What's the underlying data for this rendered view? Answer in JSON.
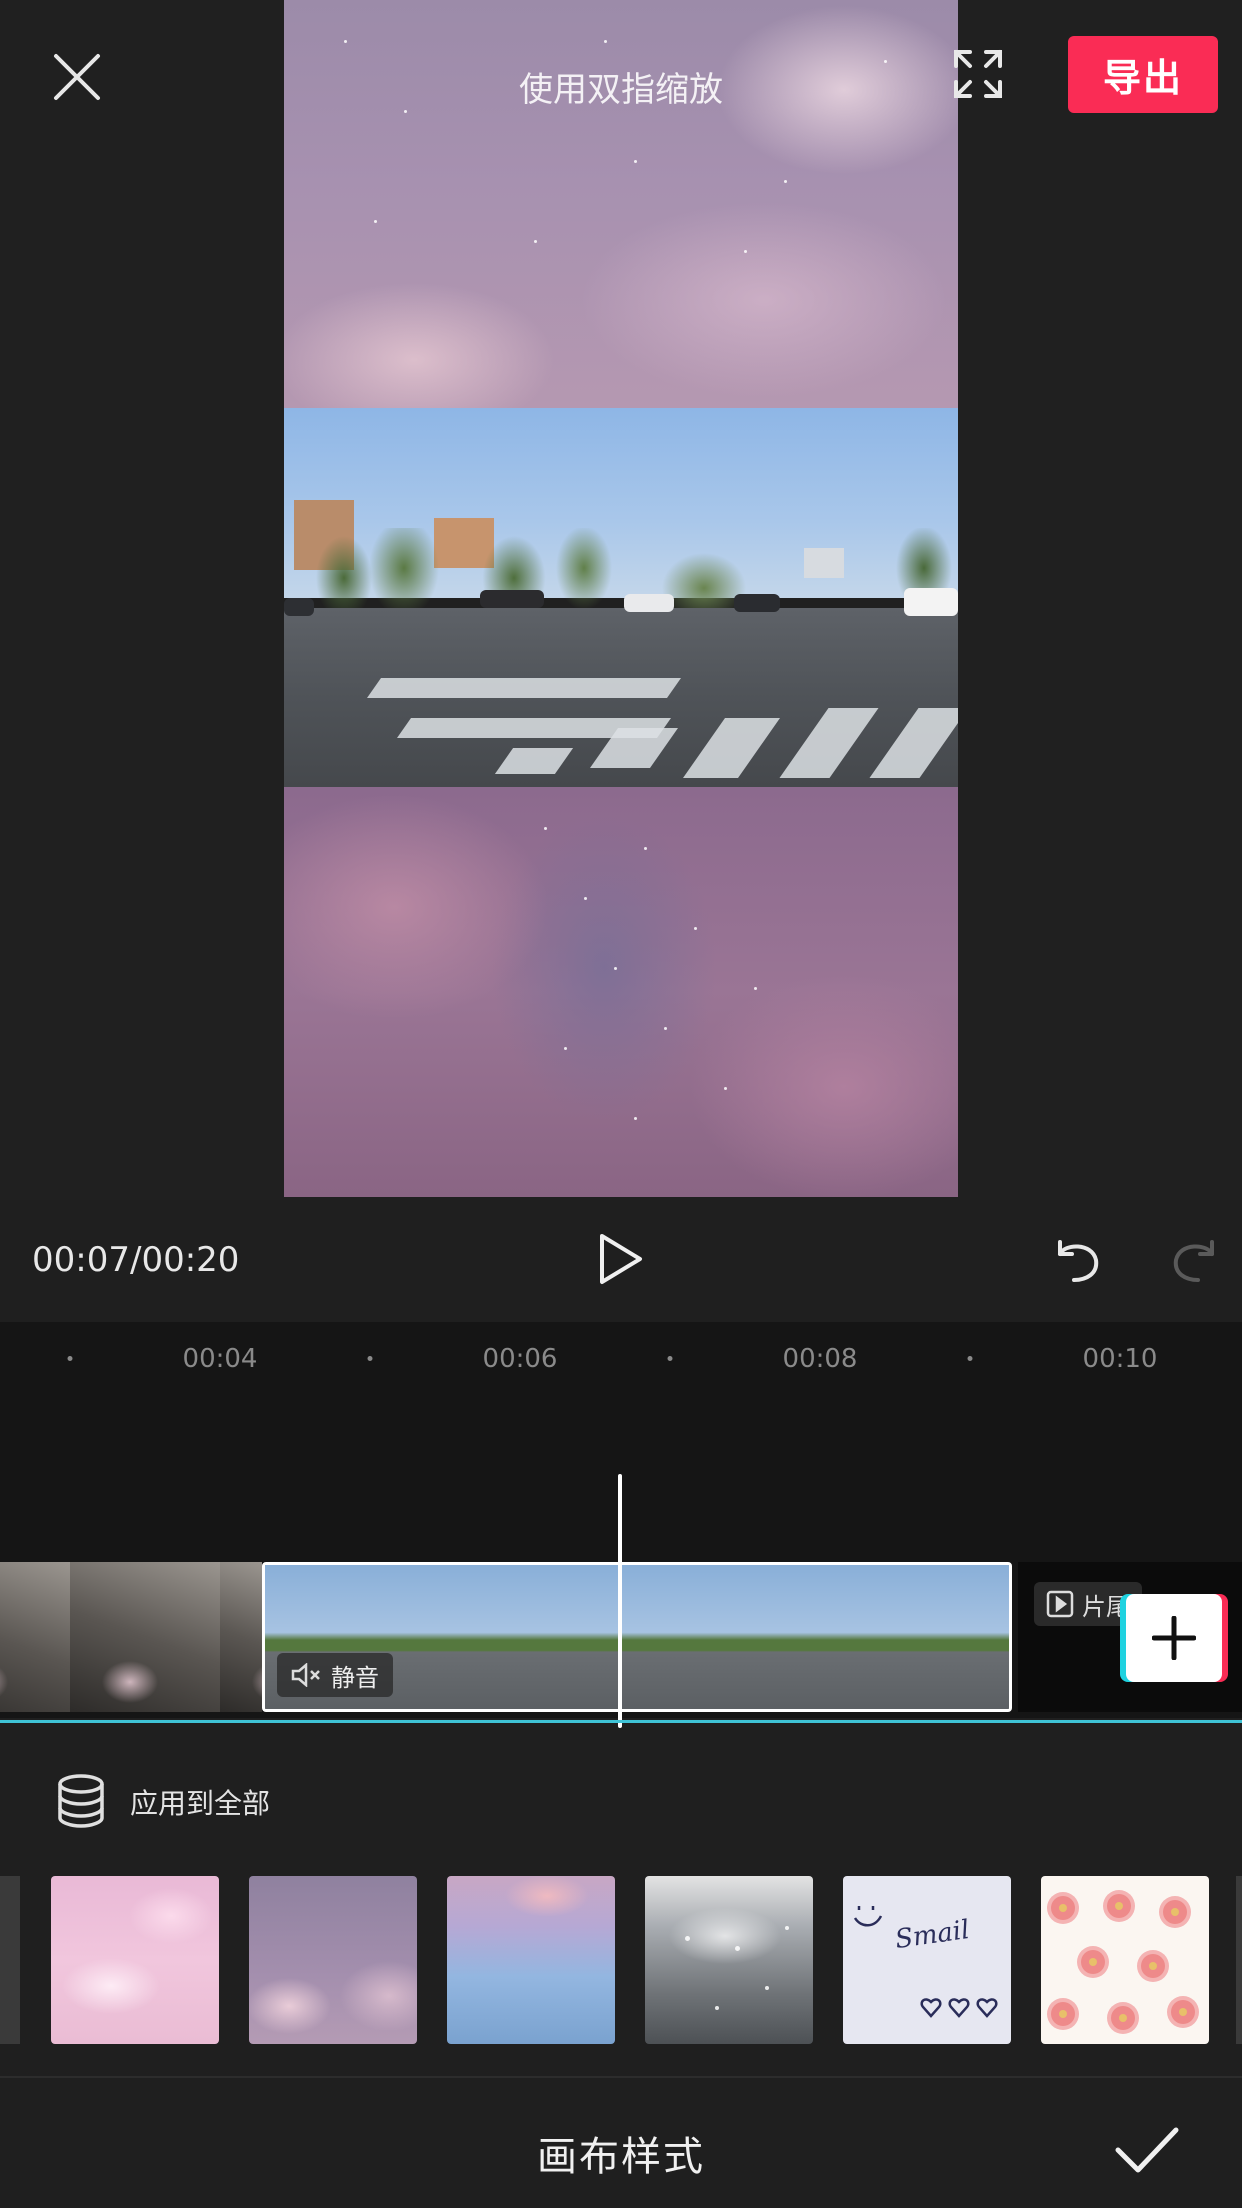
{
  "preview": {
    "pinch_hint": "使用双指缩放",
    "export_label": "导出"
  },
  "playback": {
    "current_time": "00:07",
    "total_time": "00:20",
    "time_display": "00:07/00:20"
  },
  "timeline": {
    "ruler_labels": [
      "00:04",
      "00:06",
      "00:08",
      "00:10"
    ],
    "selected_clip": {
      "mute_label": "静音"
    },
    "ending_clip_label": "片尾"
  },
  "canvas_panel": {
    "apply_all_label": "应用到全部",
    "title": "画布样式",
    "swatches": [
      "pink-clouds",
      "purple-moon-sky",
      "sunset-ocean",
      "sparkling-water",
      "smile-doodle",
      "pink-flowers"
    ],
    "smile_doodle_text": "Smail"
  },
  "colors": {
    "accent": "#fa2c55",
    "timeline_accent": "#3fc3d6",
    "background": "#1f1f1f"
  },
  "icons": {
    "close": "close-icon",
    "fullscreen": "fullscreen-icon",
    "play": "play-icon",
    "undo": "undo-icon",
    "redo": "redo-icon",
    "mute": "mute-icon",
    "ending": "ending-clip-icon",
    "add": "plus-icon",
    "layers": "layers-icon",
    "confirm": "check-icon"
  }
}
